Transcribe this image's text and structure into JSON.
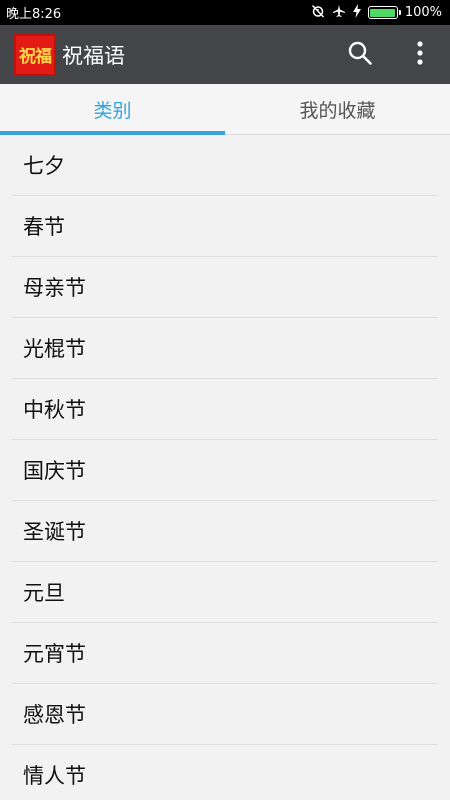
{
  "status_bar": {
    "time": "晚上8:26",
    "battery_text": "100%",
    "battery_level": 1.0,
    "icons": [
      "alarm-off-icon",
      "airplane-icon",
      "charging-icon",
      "battery-icon"
    ]
  },
  "app_bar": {
    "logo_text": "祝福",
    "title": "祝福语",
    "actions": [
      "search-icon",
      "overflow-menu-icon"
    ],
    "background_color": "#444548"
  },
  "tabs": [
    {
      "label": "类别",
      "active": true
    },
    {
      "label": "我的收藏",
      "active": false
    }
  ],
  "accent_color": "#33a3dc",
  "categories": [
    "七夕",
    "春节",
    "母亲节",
    "光棍节",
    "中秋节",
    "国庆节",
    "圣诞节",
    "元旦",
    "元宵节",
    "感恩节",
    "情人节"
  ]
}
